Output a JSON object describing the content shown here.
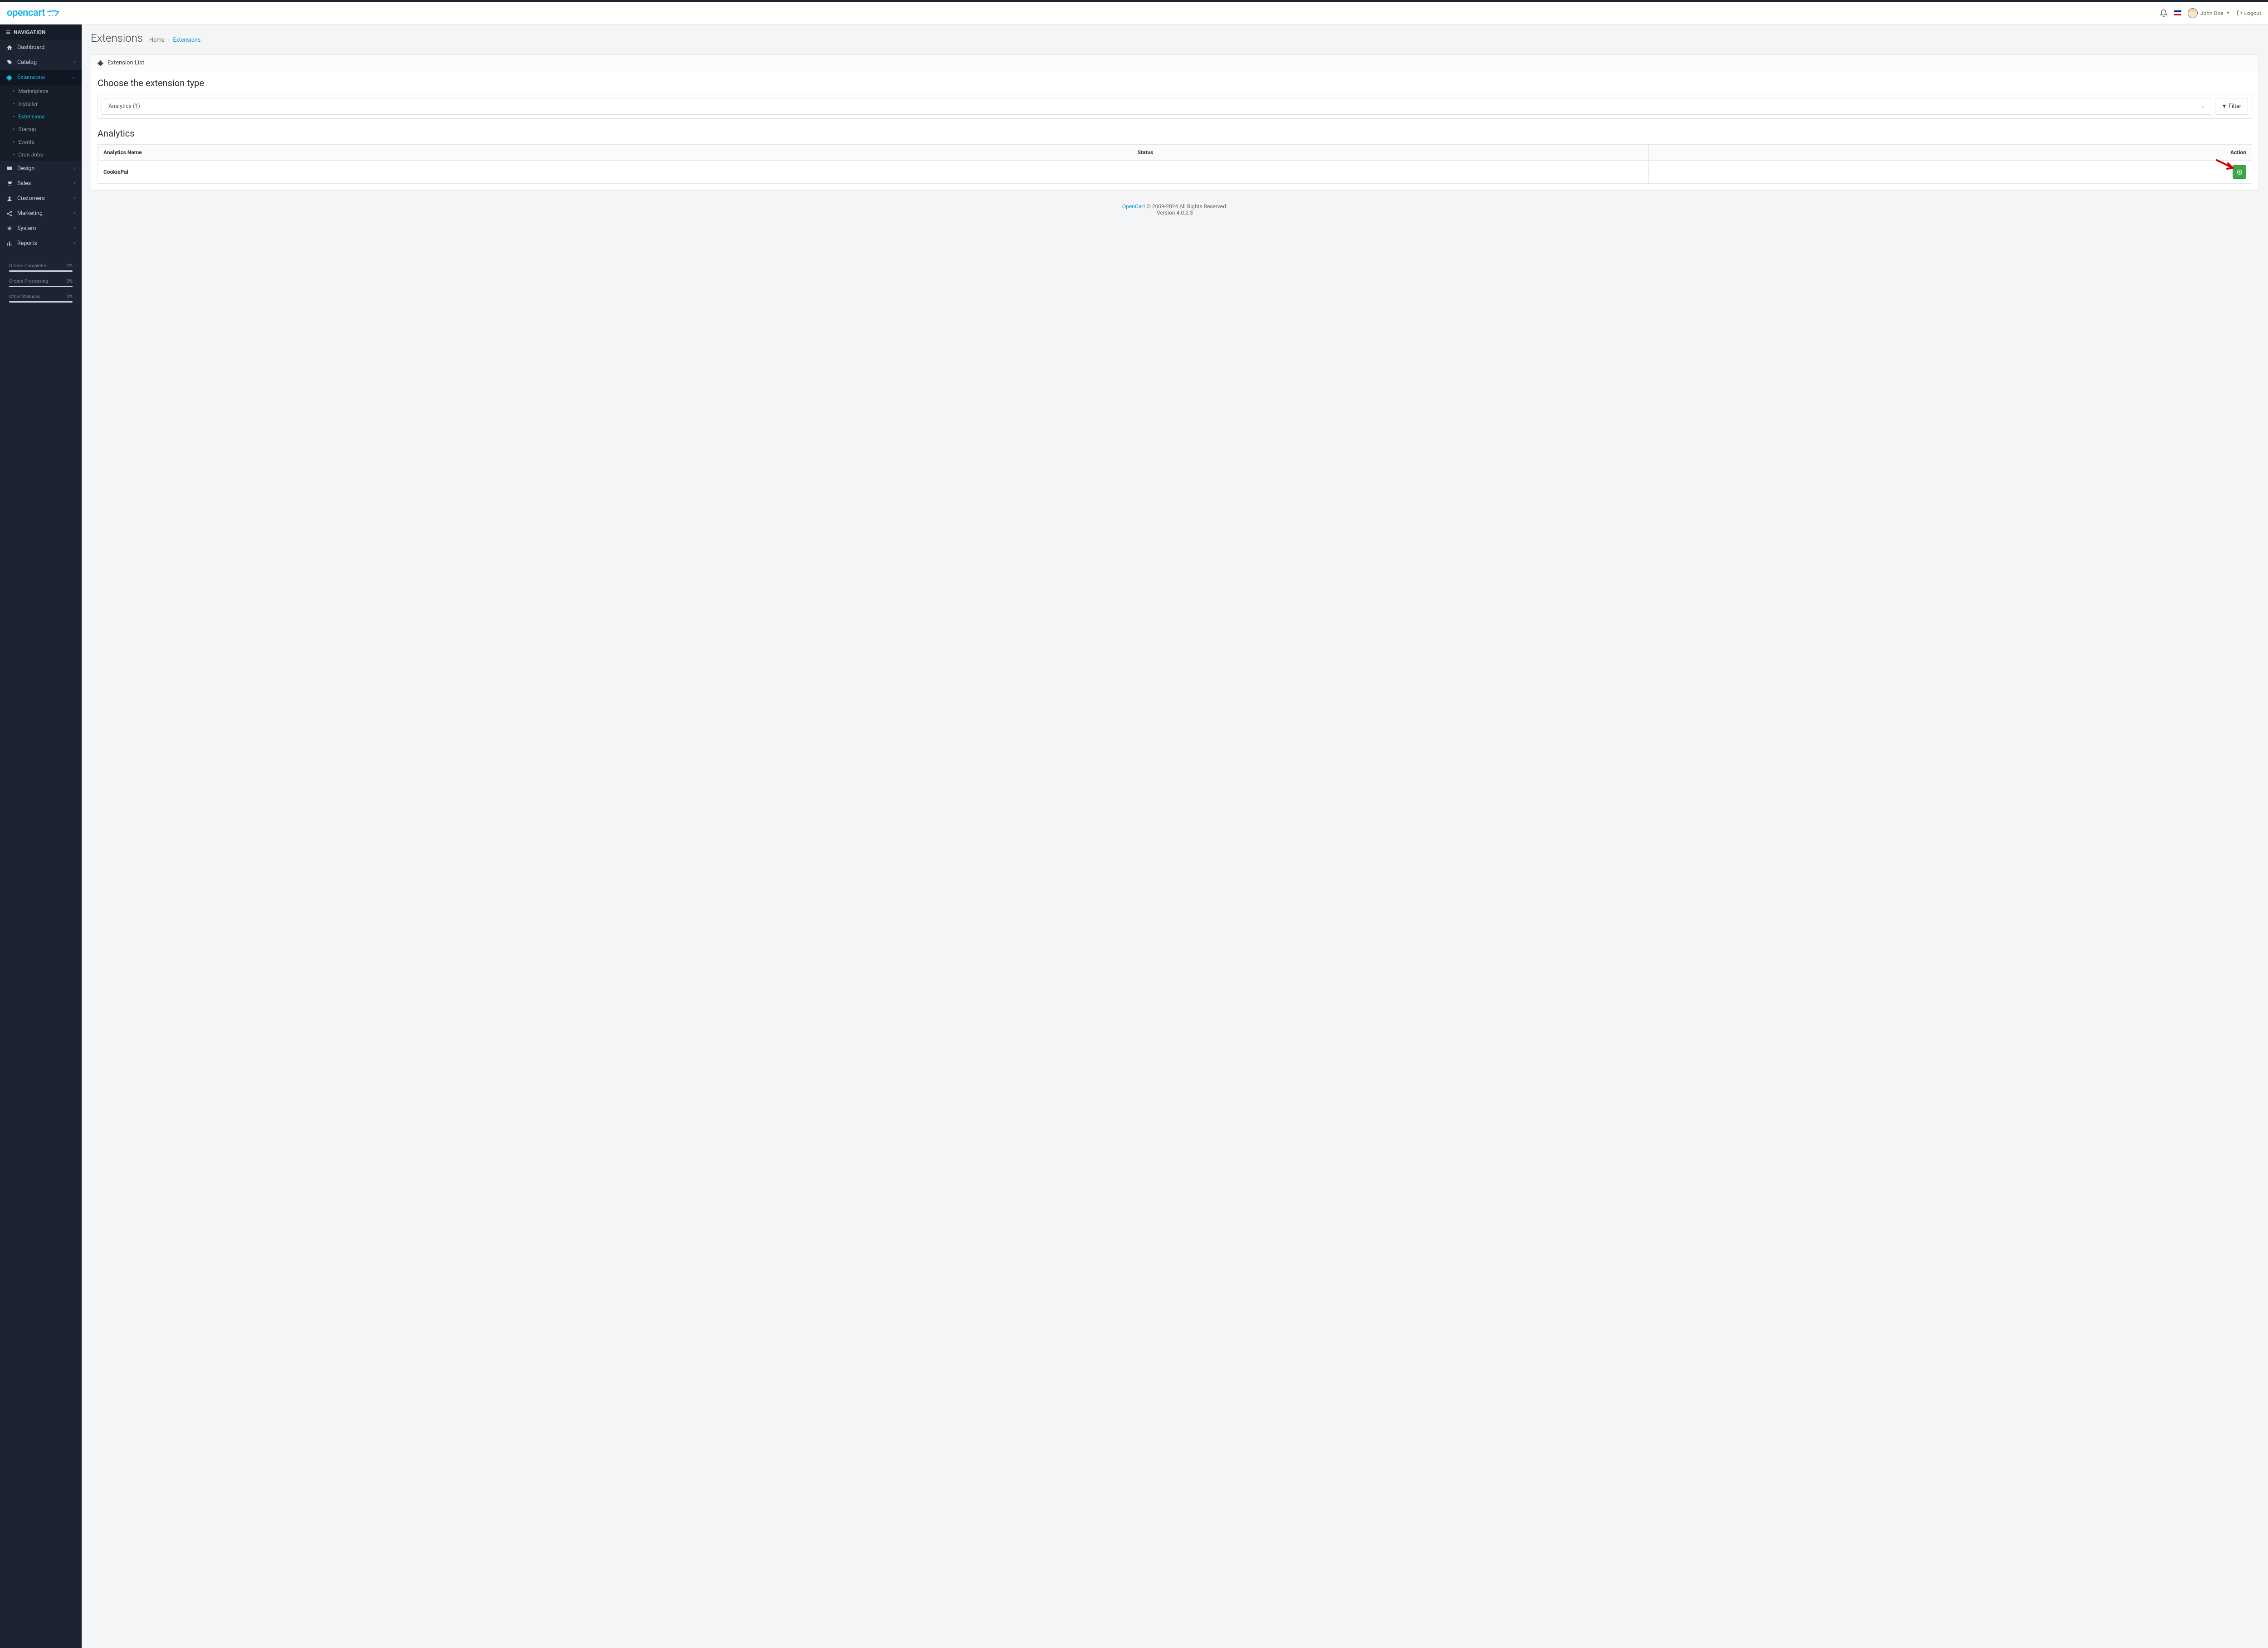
{
  "brand": "opencart",
  "header": {
    "user_name": "John Doe",
    "logout": "Logout"
  },
  "sidebar": {
    "heading": "NAVIGATION",
    "items": [
      {
        "label": "Dashboard",
        "icon": "home"
      },
      {
        "label": "Catalog",
        "icon": "tag",
        "children": true
      },
      {
        "label": "Extensions",
        "icon": "puzzle",
        "children": true,
        "active": true
      },
      {
        "label": "Design",
        "icon": "monitor",
        "children": true
      },
      {
        "label": "Sales",
        "icon": "cart",
        "children": true
      },
      {
        "label": "Customers",
        "icon": "user",
        "children": true
      },
      {
        "label": "Marketing",
        "icon": "share",
        "children": true
      },
      {
        "label": "System",
        "icon": "gear",
        "children": true
      },
      {
        "label": "Reports",
        "icon": "chart",
        "children": true
      }
    ],
    "extensions_sub": [
      {
        "label": "Marketplace"
      },
      {
        "label": "Installer"
      },
      {
        "label": "Extensions",
        "active": true
      },
      {
        "label": "Startup"
      },
      {
        "label": "Events"
      },
      {
        "label": "Cron Jobs"
      }
    ],
    "stats": [
      {
        "label": "Orders Completed",
        "value": "0%"
      },
      {
        "label": "Orders Processing",
        "value": "0%"
      },
      {
        "label": "Other Statuses",
        "value": "0%"
      }
    ]
  },
  "page": {
    "title": "Extensions",
    "breadcrumb_home": "Home",
    "breadcrumb_current": "Extensions"
  },
  "panel": {
    "title": "Extension List",
    "choose_label": "Choose the extension type",
    "selected_type": "Analytics (1)",
    "filter_label": "Filter",
    "section_title": "Analytics",
    "columns": {
      "name": "Analytics Name",
      "status": "Status",
      "action": "Action"
    },
    "rows": [
      {
        "name": "CookiePal",
        "status": ""
      }
    ]
  },
  "footer": {
    "brand": "OpenCart",
    "rights": " © 2009-2024 All Rights Reserved.",
    "version": "Version 4.0.2.3"
  }
}
